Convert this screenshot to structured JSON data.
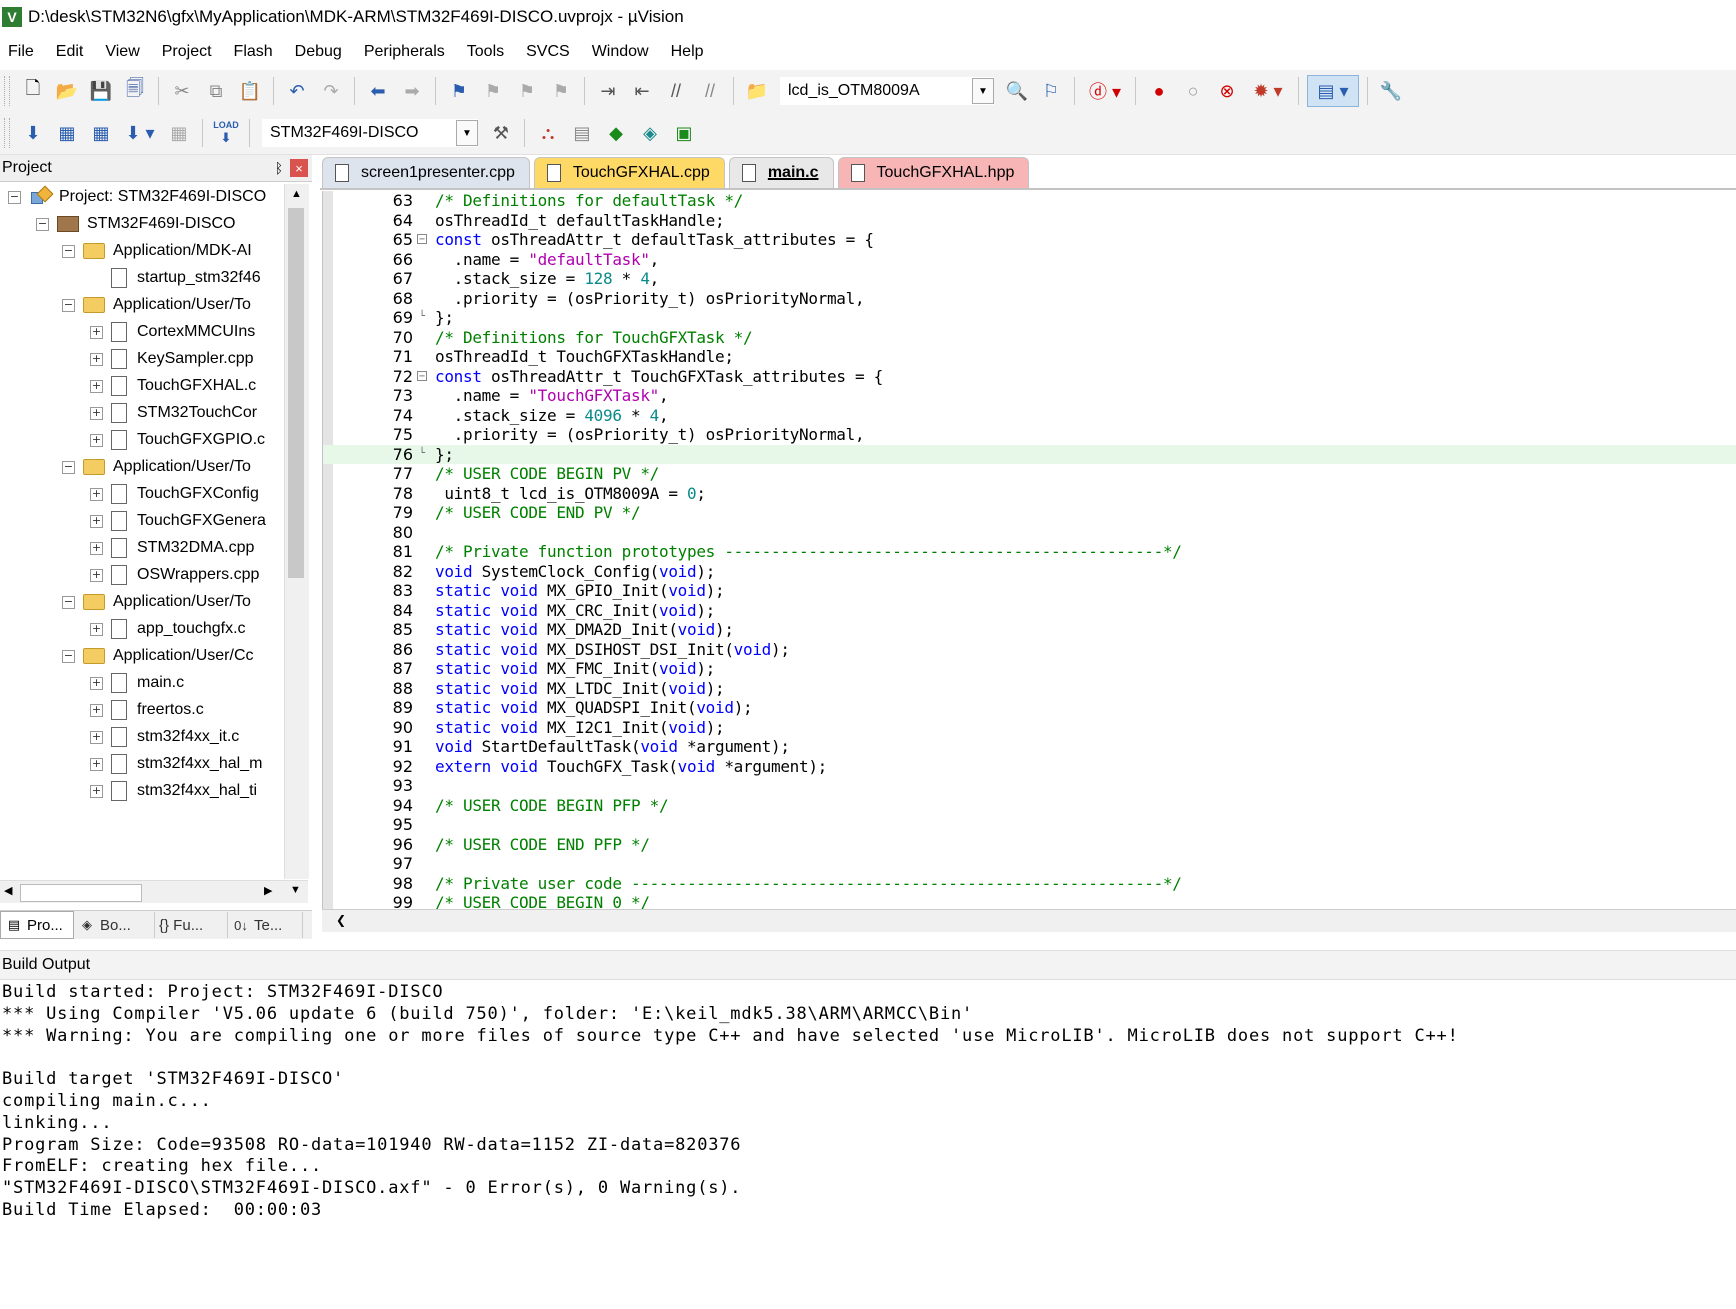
{
  "window": {
    "title": "D:\\desk\\STM32N6\\gfx\\MyApplication\\MDK-ARM\\STM32F469I-DISCO.uvprojx - µVision",
    "app_icon": "uvision-icon"
  },
  "menu": [
    "File",
    "Edit",
    "View",
    "Project",
    "Flash",
    "Debug",
    "Peripherals",
    "Tools",
    "SVCS",
    "Window",
    "Help"
  ],
  "toolbar1": {
    "find_combo_value": "lcd_is_OTM8009A"
  },
  "toolbar2": {
    "load_label": "LOAD",
    "target_combo_value": "STM32F469I-DISCO"
  },
  "project_panel": {
    "title": "Project",
    "pin_glyph": "ᛒ",
    "close_glyph": "×",
    "tree": [
      {
        "text": "Project: STM32F469I-DISCO",
        "level": 0,
        "kind": "project",
        "exp": "−"
      },
      {
        "text": "STM32F469I-DISCO",
        "level": 1,
        "kind": "target",
        "exp": "−"
      },
      {
        "text": "Application/MDK-AI",
        "level": 2,
        "kind": "folder",
        "exp": "−"
      },
      {
        "text": "startup_stm32f46",
        "level": 3,
        "kind": "file",
        "exp": ""
      },
      {
        "text": "Application/User/To",
        "level": 2,
        "kind": "folder",
        "exp": "−"
      },
      {
        "text": "CortexMMCUIns",
        "level": 3,
        "kind": "file",
        "exp": "+"
      },
      {
        "text": "KeySampler.cpp",
        "level": 3,
        "kind": "file",
        "exp": "+"
      },
      {
        "text": "TouchGFXHAL.c",
        "level": 3,
        "kind": "file",
        "exp": "+"
      },
      {
        "text": "STM32TouchCor",
        "level": 3,
        "kind": "file",
        "exp": "+"
      },
      {
        "text": "TouchGFXGPIO.c",
        "level": 3,
        "kind": "file",
        "exp": "+"
      },
      {
        "text": "Application/User/To",
        "level": 2,
        "kind": "folder",
        "exp": "−"
      },
      {
        "text": "TouchGFXConfig",
        "level": 3,
        "kind": "file",
        "exp": "+"
      },
      {
        "text": "TouchGFXGenera",
        "level": 3,
        "kind": "file",
        "exp": "+"
      },
      {
        "text": "STM32DMA.cpp",
        "level": 3,
        "kind": "file",
        "exp": "+"
      },
      {
        "text": "OSWrappers.cpp",
        "level": 3,
        "kind": "file",
        "exp": "+"
      },
      {
        "text": "Application/User/To",
        "level": 2,
        "kind": "folder",
        "exp": "−"
      },
      {
        "text": "app_touchgfx.c",
        "level": 3,
        "kind": "file",
        "exp": "+"
      },
      {
        "text": "Application/User/Cc",
        "level": 2,
        "kind": "folder",
        "exp": "−"
      },
      {
        "text": "main.c",
        "level": 3,
        "kind": "file",
        "exp": "+"
      },
      {
        "text": "freertos.c",
        "level": 3,
        "kind": "file",
        "exp": "+"
      },
      {
        "text": "stm32f4xx_it.c",
        "level": 3,
        "kind": "file",
        "exp": "+"
      },
      {
        "text": "stm32f4xx_hal_m",
        "level": 3,
        "kind": "file",
        "exp": "+"
      },
      {
        "text": "stm32f4xx_hal_ti",
        "level": 3,
        "kind": "file",
        "exp": "+"
      }
    ],
    "bottom_tabs": [
      {
        "label": "Pro...",
        "icon": "project-tab-icon",
        "glyph": "▤",
        "active": true
      },
      {
        "label": "Bo...",
        "icon": "books-tab-icon",
        "glyph": "◈",
        "active": false
      },
      {
        "label": "{} Fu...",
        "icon": "functions-tab-icon",
        "glyph": "",
        "active": false
      },
      {
        "label": "Te...",
        "icon": "templates-tab-icon",
        "glyph": "0↓",
        "active": false
      }
    ]
  },
  "editor": {
    "tabs": [
      {
        "label": "screen1presenter.cpp",
        "style": "t1"
      },
      {
        "label": "TouchGFXHAL.cpp",
        "style": "t2"
      },
      {
        "label": "main.c",
        "style": "t3",
        "active": true
      },
      {
        "label": "TouchGFXHAL.hpp",
        "style": "t4"
      }
    ],
    "lines": [
      {
        "n": "63",
        "fold": "",
        "hl": false,
        "tokens": [
          [
            "cm",
            "/* Definitions for defaultTask */"
          ]
        ]
      },
      {
        "n": "64",
        "fold": "",
        "hl": false,
        "tokens": [
          [
            "plain",
            "osThreadId_t defaultTaskHandle;"
          ]
        ]
      },
      {
        "n": "65",
        "fold": "box",
        "hl": false,
        "tokens": [
          [
            "kw",
            "const"
          ],
          [
            "plain",
            " osThreadAttr_t defaultTask_attributes = {"
          ]
        ]
      },
      {
        "n": "66",
        "fold": "",
        "hl": false,
        "tokens": [
          [
            "plain",
            "  .name = "
          ],
          [
            "str",
            "\"defaultTask\""
          ],
          [
            "plain",
            ","
          ]
        ]
      },
      {
        "n": "67",
        "fold": "",
        "hl": false,
        "tokens": [
          [
            "plain",
            "  .stack_size = "
          ],
          [
            "num",
            "128"
          ],
          [
            "plain",
            " * "
          ],
          [
            "num",
            "4"
          ],
          [
            "plain",
            ","
          ]
        ]
      },
      {
        "n": "68",
        "fold": "",
        "hl": false,
        "tokens": [
          [
            "plain",
            "  .priority = (osPriority_t) osPriorityNormal,"
          ]
        ]
      },
      {
        "n": "69",
        "fold": "end",
        "hl": false,
        "tokens": [
          [
            "plain",
            "};"
          ]
        ]
      },
      {
        "n": "70",
        "fold": "",
        "hl": false,
        "tokens": [
          [
            "cm",
            "/* Definitions for TouchGFXTask */"
          ]
        ]
      },
      {
        "n": "71",
        "fold": "",
        "hl": false,
        "tokens": [
          [
            "plain",
            "osThreadId_t TouchGFXTaskHandle;"
          ]
        ]
      },
      {
        "n": "72",
        "fold": "box",
        "hl": false,
        "tokens": [
          [
            "kw",
            "const"
          ],
          [
            "plain",
            " osThreadAttr_t TouchGFXTask_attributes = {"
          ]
        ]
      },
      {
        "n": "73",
        "fold": "",
        "hl": false,
        "tokens": [
          [
            "plain",
            "  .name = "
          ],
          [
            "str",
            "\"TouchGFXTask\""
          ],
          [
            "plain",
            ","
          ]
        ]
      },
      {
        "n": "74",
        "fold": "",
        "hl": false,
        "tokens": [
          [
            "plain",
            "  .stack_size = "
          ],
          [
            "num",
            "4096"
          ],
          [
            "plain",
            " * "
          ],
          [
            "num",
            "4"
          ],
          [
            "plain",
            ","
          ]
        ]
      },
      {
        "n": "75",
        "fold": "",
        "hl": false,
        "tokens": [
          [
            "plain",
            "  .priority = (osPriority_t) osPriorityNormal,"
          ]
        ]
      },
      {
        "n": "76",
        "fold": "end",
        "hl": true,
        "tokens": [
          [
            "plain",
            "};"
          ]
        ]
      },
      {
        "n": "77",
        "fold": "",
        "hl": false,
        "tokens": [
          [
            "cm",
            "/* USER CODE BEGIN PV */"
          ]
        ]
      },
      {
        "n": "78",
        "fold": "",
        "hl": false,
        "tokens": [
          [
            "plain",
            " uint8_t lcd_is_OTM8009A = "
          ],
          [
            "num",
            "0"
          ],
          [
            "plain",
            ";"
          ]
        ]
      },
      {
        "n": "79",
        "fold": "",
        "hl": false,
        "tokens": [
          [
            "cm",
            "/* USER CODE END PV */"
          ]
        ]
      },
      {
        "n": "80",
        "fold": "",
        "hl": false,
        "tokens": []
      },
      {
        "n": "81",
        "fold": "",
        "hl": false,
        "tokens": [
          [
            "cm",
            "/* Private function prototypes -----------------------------------------------*/"
          ]
        ]
      },
      {
        "n": "82",
        "fold": "",
        "hl": false,
        "tokens": [
          [
            "kw",
            "void"
          ],
          [
            "plain",
            " SystemClock_Config("
          ],
          [
            "kw",
            "void"
          ],
          [
            "plain",
            ");"
          ]
        ]
      },
      {
        "n": "83",
        "fold": "",
        "hl": false,
        "tokens": [
          [
            "kw",
            "static void"
          ],
          [
            "plain",
            " MX_GPIO_Init("
          ],
          [
            "kw",
            "void"
          ],
          [
            "plain",
            ");"
          ]
        ]
      },
      {
        "n": "84",
        "fold": "",
        "hl": false,
        "tokens": [
          [
            "kw",
            "static void"
          ],
          [
            "plain",
            " MX_CRC_Init("
          ],
          [
            "kw",
            "void"
          ],
          [
            "plain",
            ");"
          ]
        ]
      },
      {
        "n": "85",
        "fold": "",
        "hl": false,
        "tokens": [
          [
            "kw",
            "static void"
          ],
          [
            "plain",
            " MX_DMA2D_Init("
          ],
          [
            "kw",
            "void"
          ],
          [
            "plain",
            ");"
          ]
        ]
      },
      {
        "n": "86",
        "fold": "",
        "hl": false,
        "tokens": [
          [
            "kw",
            "static void"
          ],
          [
            "plain",
            " MX_DSIHOST_DSI_Init("
          ],
          [
            "kw",
            "void"
          ],
          [
            "plain",
            ");"
          ]
        ]
      },
      {
        "n": "87",
        "fold": "",
        "hl": false,
        "tokens": [
          [
            "kw",
            "static void"
          ],
          [
            "plain",
            " MX_FMC_Init("
          ],
          [
            "kw",
            "void"
          ],
          [
            "plain",
            ");"
          ]
        ]
      },
      {
        "n": "88",
        "fold": "",
        "hl": false,
        "tokens": [
          [
            "kw",
            "static void"
          ],
          [
            "plain",
            " MX_LTDC_Init("
          ],
          [
            "kw",
            "void"
          ],
          [
            "plain",
            ");"
          ]
        ]
      },
      {
        "n": "89",
        "fold": "",
        "hl": false,
        "tokens": [
          [
            "kw",
            "static void"
          ],
          [
            "plain",
            " MX_QUADSPI_Init("
          ],
          [
            "kw",
            "void"
          ],
          [
            "plain",
            ");"
          ]
        ]
      },
      {
        "n": "90",
        "fold": "",
        "hl": false,
        "tokens": [
          [
            "kw",
            "static void"
          ],
          [
            "plain",
            " MX_I2C1_Init("
          ],
          [
            "kw",
            "void"
          ],
          [
            "plain",
            ");"
          ]
        ]
      },
      {
        "n": "91",
        "fold": "",
        "hl": false,
        "tokens": [
          [
            "kw",
            "void"
          ],
          [
            "plain",
            " StartDefaultTask("
          ],
          [
            "kw",
            "void"
          ],
          [
            "plain",
            " *argument);"
          ]
        ]
      },
      {
        "n": "92",
        "fold": "",
        "hl": false,
        "tokens": [
          [
            "kw",
            "extern void"
          ],
          [
            "plain",
            " TouchGFX_Task("
          ],
          [
            "kw",
            "void"
          ],
          [
            "plain",
            " *argument);"
          ]
        ]
      },
      {
        "n": "93",
        "fold": "",
        "hl": false,
        "tokens": []
      },
      {
        "n": "94",
        "fold": "",
        "hl": false,
        "tokens": [
          [
            "cm",
            "/* USER CODE BEGIN PFP */"
          ]
        ]
      },
      {
        "n": "95",
        "fold": "",
        "hl": false,
        "tokens": []
      },
      {
        "n": "96",
        "fold": "",
        "hl": false,
        "tokens": [
          [
            "cm",
            "/* USER CODE END PFP */"
          ]
        ]
      },
      {
        "n": "97",
        "fold": "",
        "hl": false,
        "tokens": []
      },
      {
        "n": "98",
        "fold": "",
        "hl": false,
        "tokens": [
          [
            "cm",
            "/* Private user code ---------------------------------------------------------*/"
          ]
        ]
      },
      {
        "n": "99",
        "fold": "",
        "hl": false,
        "tokens": [
          [
            "cm",
            "/* USER CODE BEGIN 0 */"
          ]
        ]
      }
    ]
  },
  "build_output": {
    "title": "Build Output",
    "lines": [
      "Build started: Project: STM32F469I-DISCO",
      "*** Using Compiler 'V5.06 update 6 (build 750)', folder: 'E:\\keil_mdk5.38\\ARM\\ARMCC\\Bin'",
      "*** Warning: You are compiling one or more files of source type C++ and have selected 'use MicroLIB'. MicroLIB does not support C++!",
      "",
      "Build target 'STM32F469I-DISCO'",
      "compiling main.c...",
      "linking...",
      "Program Size: Code=93508 RO-data=101940 RW-data=1152 ZI-data=820376",
      "FromELF: creating hex file...",
      "\"STM32F469I-DISCO\\STM32F469I-DISCO.axf\" - 0 Error(s), 0 Warning(s).",
      "Build Time Elapsed:  00:00:03"
    ]
  }
}
